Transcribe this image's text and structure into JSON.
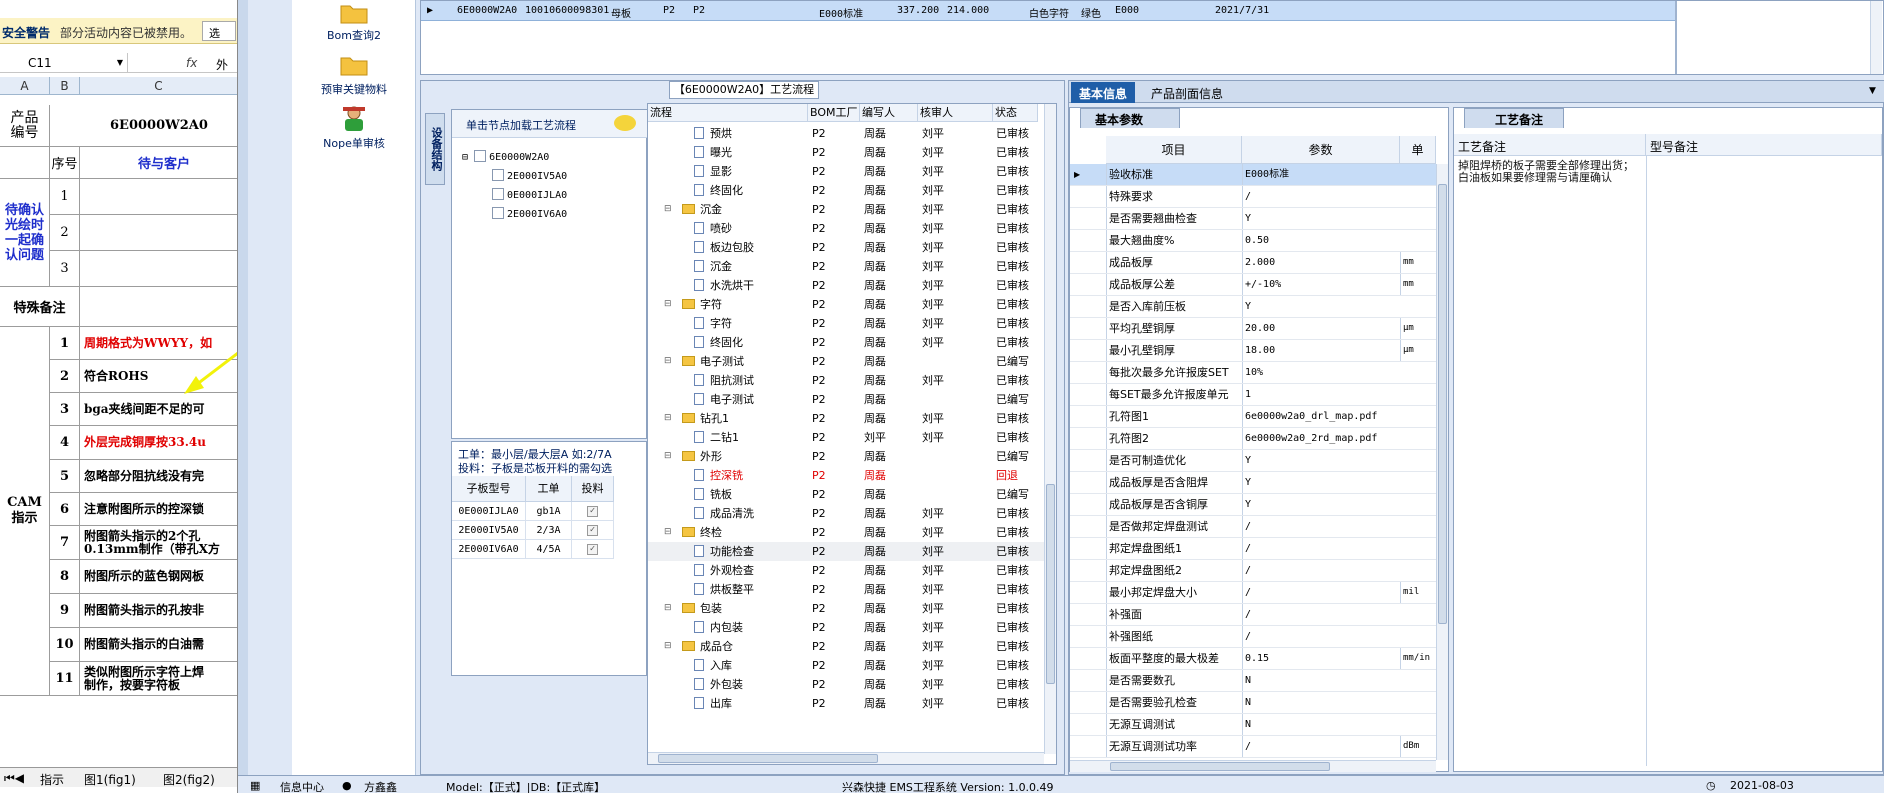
{
  "excel": {
    "warn_title": "安全警告",
    "warn_text": "部分活动内容已被禁用。",
    "warn_button": "选",
    "name_box": "C11",
    "fx": "fx",
    "formula_value": "外",
    "columns": [
      "A",
      "B",
      "C"
    ],
    "product_label": "产品\n编号",
    "product_no": "6E0000W2A0",
    "seq_header": "序号",
    "pending_header": "待与客户",
    "confirm_label": "待确认\n光绘时\n一起确\n认问题",
    "confirm_rows": [
      "1",
      "2",
      "3"
    ],
    "special_label": "特殊备注",
    "cam_label": "CAM\n指示",
    "cam_rows": [
      {
        "n": "1",
        "t": "周期格式为WWYY，如",
        "red": true
      },
      {
        "n": "2",
        "t": "符合ROHS",
        "red": false
      },
      {
        "n": "3",
        "t": "bga夹线间距不足的可",
        "red": false
      },
      {
        "n": "4",
        "t": "外层完成铜厚按33.4u",
        "red": true
      },
      {
        "n": "5",
        "t": "忽略部分阻抗线没有完",
        "red": false
      },
      {
        "n": "6",
        "t": "注意附图所示的控深锁",
        "red": false
      },
      {
        "n": "7",
        "t": "附图箭头指示的2个孔\n0.13mm制作（带孔X方",
        "red": false
      },
      {
        "n": "8",
        "t": "附图所示的蓝色钢网板",
        "red": false
      },
      {
        "n": "9",
        "t": "附图箭头指示的孔按非",
        "red": false
      },
      {
        "n": "10",
        "t": "附图箭头指示的白油需",
        "red": false
      },
      {
        "n": "11",
        "t": "类似附图所示字符上焊\n制作，按要字符板",
        "red": false
      }
    ],
    "sheet_tabs": [
      "指示",
      "图1(fig1)",
      "图2(fig2)"
    ]
  },
  "tools": [
    {
      "label": "Bom查询2",
      "icon": "folder-icon"
    },
    {
      "label": "预审关键物料",
      "icon": "folder-icon"
    },
    {
      "label": "Nope单审核",
      "icon": "user-icon"
    }
  ],
  "top_row": {
    "cells": [
      "6E0000W2A0",
      "10010600098301",
      "母板",
      "P2",
      "P2",
      "E000标准",
      "337.200",
      "214.000",
      "白色字符",
      "绿色",
      "E000",
      "2021/7/31"
    ]
  },
  "process": {
    "header": "【6E0000W2A0】工艺流程",
    "vtab": "设备结构",
    "tree_caption": "单击节点加载工艺流程",
    "tree": [
      "6E0000W2A0",
      "2E000IV5A0",
      "0E000IJLA0",
      "2E000IV6A0"
    ],
    "work_line1": "工单：最小层/最大层A 如:2/7A",
    "work_line2": "投料：子板是芯板开料的需勾选",
    "work_headers": [
      "子板型号",
      "工单",
      "投料"
    ],
    "work_rows": [
      [
        "0E000IJLA0",
        "gb1A"
      ],
      [
        "2E000IV5A0",
        "2/3A"
      ],
      [
        "2E000IV6A0",
        "4/5A"
      ]
    ],
    "flow_headers": [
      "流程",
      "BOM工厂",
      "编写人",
      "核审人",
      "状态"
    ],
    "flow_rows": [
      {
        "lvl": 2,
        "name": "预烘",
        "fac": "P2",
        "w": "周磊",
        "r": "刘平",
        "s": "已审核"
      },
      {
        "lvl": 2,
        "name": "曝光",
        "fac": "P2",
        "w": "周磊",
        "r": "刘平",
        "s": "已审核"
      },
      {
        "lvl": 2,
        "name": "显影",
        "fac": "P2",
        "w": "周磊",
        "r": "刘平",
        "s": "已审核"
      },
      {
        "lvl": 2,
        "name": "终固化",
        "fac": "P2",
        "w": "周磊",
        "r": "刘平",
        "s": "已审核"
      },
      {
        "lvl": 1,
        "name": "沉金",
        "fac": "P2",
        "w": "周磊",
        "r": "刘平",
        "s": "已审核"
      },
      {
        "lvl": 2,
        "name": "喷砂",
        "fac": "P2",
        "w": "周磊",
        "r": "刘平",
        "s": "已审核"
      },
      {
        "lvl": 2,
        "name": "板边包胶",
        "fac": "P2",
        "w": "周磊",
        "r": "刘平",
        "s": "已审核"
      },
      {
        "lvl": 2,
        "name": "沉金",
        "fac": "P2",
        "w": "周磊",
        "r": "刘平",
        "s": "已审核"
      },
      {
        "lvl": 2,
        "name": "水洗烘干",
        "fac": "P2",
        "w": "周磊",
        "r": "刘平",
        "s": "已审核"
      },
      {
        "lvl": 1,
        "name": "字符",
        "fac": "P2",
        "w": "周磊",
        "r": "刘平",
        "s": "已审核"
      },
      {
        "lvl": 2,
        "name": "字符",
        "fac": "P2",
        "w": "周磊",
        "r": "刘平",
        "s": "已审核"
      },
      {
        "lvl": 2,
        "name": "终固化",
        "fac": "P2",
        "w": "周磊",
        "r": "刘平",
        "s": "已审核"
      },
      {
        "lvl": 1,
        "name": "电子测试",
        "fac": "P2",
        "w": "周磊",
        "r": "",
        "s": "已编写"
      },
      {
        "lvl": 2,
        "name": "阻抗测试",
        "fac": "P2",
        "w": "周磊",
        "r": "刘平",
        "s": "已审核"
      },
      {
        "lvl": 2,
        "name": "电子测试",
        "fac": "P2",
        "w": "周磊",
        "r": "",
        "s": "已编写"
      },
      {
        "lvl": 1,
        "name": "钻孔1",
        "fac": "P2",
        "w": "周磊",
        "r": "刘平",
        "s": "已审核"
      },
      {
        "lvl": 2,
        "name": "二钻1",
        "fac": "P2",
        "w": "刘平",
        "r": "刘平",
        "s": "已审核"
      },
      {
        "lvl": 1,
        "name": "外形",
        "fac": "P2",
        "w": "周磊",
        "r": "",
        "s": "已编写"
      },
      {
        "lvl": 2,
        "name": "控深铣",
        "fac": "P2",
        "w": "周磊",
        "r": "",
        "s": "回退",
        "red": true
      },
      {
        "lvl": 2,
        "name": "铣板",
        "fac": "P2",
        "w": "周磊",
        "r": "",
        "s": "已编写"
      },
      {
        "lvl": 2,
        "name": "成品清洗",
        "fac": "P2",
        "w": "周磊",
        "r": "刘平",
        "s": "已审核"
      },
      {
        "lvl": 1,
        "name": "终检",
        "fac": "P2",
        "w": "周磊",
        "r": "刘平",
        "s": "已审核"
      },
      {
        "lvl": 2,
        "name": "功能检查",
        "fac": "P2",
        "w": "周磊",
        "r": "刘平",
        "s": "已审核",
        "sel": true
      },
      {
        "lvl": 2,
        "name": "外观检查",
        "fac": "P2",
        "w": "周磊",
        "r": "刘平",
        "s": "已审核"
      },
      {
        "lvl": 2,
        "name": "烘板整平",
        "fac": "P2",
        "w": "周磊",
        "r": "刘平",
        "s": "已审核"
      },
      {
        "lvl": 1,
        "name": "包装",
        "fac": "P2",
        "w": "周磊",
        "r": "刘平",
        "s": "已审核"
      },
      {
        "lvl": 2,
        "name": "内包装",
        "fac": "P2",
        "w": "周磊",
        "r": "刘平",
        "s": "已审核"
      },
      {
        "lvl": 1,
        "name": "成品仓",
        "fac": "P2",
        "w": "周磊",
        "r": "刘平",
        "s": "已审核"
      },
      {
        "lvl": 2,
        "name": "入库",
        "fac": "P2",
        "w": "周磊",
        "r": "刘平",
        "s": "已审核"
      },
      {
        "lvl": 2,
        "name": "外包装",
        "fac": "P2",
        "w": "周磊",
        "r": "刘平",
        "s": "已审核"
      },
      {
        "lvl": 2,
        "name": "出库",
        "fac": "P2",
        "w": "周磊",
        "r": "刘平",
        "s": "已审核"
      }
    ]
  },
  "info": {
    "tabs": [
      "基本信息",
      "产品剖面信息"
    ],
    "params_tab": "基本参数",
    "params_headers": [
      "项目",
      "参数",
      "单"
    ],
    "params": [
      {
        "k": "验收标准",
        "v": "E000标准",
        "u": ""
      },
      {
        "k": "特殊要求",
        "v": "/",
        "u": ""
      },
      {
        "k": "是否需要翘曲检查",
        "v": "Y",
        "u": ""
      },
      {
        "k": "最大翘曲度%",
        "v": "0.50",
        "u": ""
      },
      {
        "k": "成品板厚",
        "v": "2.000",
        "u": "mm"
      },
      {
        "k": "成品板厚公差",
        "v": "+/-10%",
        "u": "mm"
      },
      {
        "k": "是否入库前压板",
        "v": "Y",
        "u": ""
      },
      {
        "k": "平均孔壁铜厚",
        "v": "20.00",
        "u": "μm"
      },
      {
        "k": "最小孔壁铜厚",
        "v": "18.00",
        "u": "μm"
      },
      {
        "k": "每批次最多允许报废SET",
        "v": "10%",
        "u": ""
      },
      {
        "k": "每SET最多允许报废单元",
        "v": "1",
        "u": ""
      },
      {
        "k": "孔符图1",
        "v": "6e0000w2a0_drl_map.pdf",
        "u": ""
      },
      {
        "k": "孔符图2",
        "v": "6e0000w2a0_2rd_map.pdf",
        "u": ""
      },
      {
        "k": "是否可制造优化",
        "v": "Y",
        "u": ""
      },
      {
        "k": "成品板厚是否含阻焊",
        "v": "Y",
        "u": ""
      },
      {
        "k": "成品板厚是否含铜厚",
        "v": "Y",
        "u": ""
      },
      {
        "k": "是否做邦定焊盘测试",
        "v": "/",
        "u": ""
      },
      {
        "k": "邦定焊盘图纸1",
        "v": "/",
        "u": ""
      },
      {
        "k": "邦定焊盘图纸2",
        "v": "/",
        "u": ""
      },
      {
        "k": "最小邦定焊盘大小",
        "v": "/",
        "u": "mil"
      },
      {
        "k": "补强面",
        "v": "/",
        "u": ""
      },
      {
        "k": "补强图纸",
        "v": "/",
        "u": ""
      },
      {
        "k": "板面平整度的最大极差",
        "v": "0.15",
        "u": "mm/in"
      },
      {
        "k": "是否需要数孔",
        "v": "N",
        "u": ""
      },
      {
        "k": "是否需要验孔检查",
        "v": "N",
        "u": ""
      },
      {
        "k": "无源互调测试",
        "v": "N",
        "u": ""
      },
      {
        "k": "无源互调测试功率",
        "v": "/",
        "u": "dBm"
      }
    ],
    "remarks_tab": "工艺备注",
    "remarks_headers": [
      "工艺备注",
      "型号备注"
    ],
    "remark_text": "掉阻焊桥的板子需要全部修理出货；白油板如果要修理需与请厘确认"
  },
  "status": {
    "info_center": "信息中心",
    "user": "方鑫鑫",
    "model": "Model:【正式】|DB:【正式库】",
    "system": "兴森快捷 EMS工程系统 Version: 1.0.0.49",
    "date": "2021-08-03"
  },
  "colors": {
    "accent": "#1f5ea8",
    "selection": "#c6dcf7",
    "warning": "#fcf3c5",
    "red": "#e00000"
  }
}
